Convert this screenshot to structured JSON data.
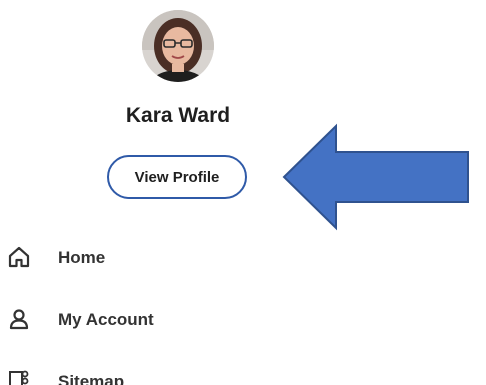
{
  "profile": {
    "name": "Kara Ward",
    "view_profile_label": "View Profile",
    "avatar_icon": "user-photo"
  },
  "annotation": {
    "arrow_icon": "left-arrow-icon",
    "arrow_color": "#4472c4",
    "arrow_outline": "#2f528f"
  },
  "nav": {
    "items": [
      {
        "label": "Home",
        "icon": "home-icon"
      },
      {
        "label": "My Account",
        "icon": "person-icon"
      },
      {
        "label": "Sitemap",
        "icon": "sitemap-icon"
      }
    ]
  },
  "colors": {
    "button_border": "#2f5aa8",
    "text_dark": "#1f1f1f",
    "nav_text": "#333333"
  }
}
